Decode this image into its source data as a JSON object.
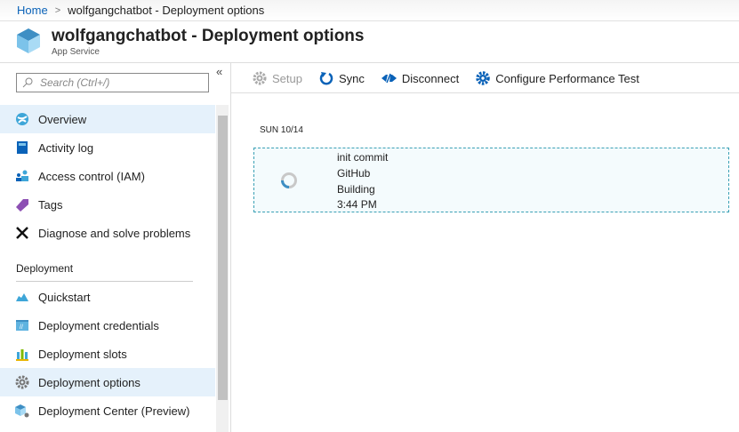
{
  "breadcrumb": {
    "home": "Home",
    "current": "wolfgangchatbot - Deployment options"
  },
  "header": {
    "title": "wolfgangchatbot - Deployment options",
    "subtitle": "App Service"
  },
  "sidebar": {
    "search_placeholder": "Search (Ctrl+/)",
    "collapse": "«",
    "items": [
      {
        "label": "Overview",
        "icon": "overview-icon"
      },
      {
        "label": "Activity log",
        "icon": "activity-log-icon"
      },
      {
        "label": "Access control (IAM)",
        "icon": "iam-icon"
      },
      {
        "label": "Tags",
        "icon": "tag-icon"
      },
      {
        "label": "Diagnose and solve problems",
        "icon": "wrench-icon"
      }
    ],
    "section": "Deployment",
    "deploy_items": [
      {
        "label": "Quickstart",
        "icon": "cloud-icon"
      },
      {
        "label": "Deployment credentials",
        "icon": "credentials-icon"
      },
      {
        "label": "Deployment slots",
        "icon": "slots-icon"
      },
      {
        "label": "Deployment options",
        "icon": "gear-icon",
        "selected": true
      },
      {
        "label": "Deployment Center (Preview)",
        "icon": "deployment-center-icon"
      }
    ]
  },
  "toolbar": {
    "setup": "Setup",
    "sync": "Sync",
    "disconnect": "Disconnect",
    "perf": "Configure Performance Test"
  },
  "deployments": {
    "date": "SUN 10/14",
    "entry": {
      "message": "init commit",
      "source": "GitHub",
      "status": "Building",
      "time": "3:44 PM"
    }
  },
  "colors": {
    "accent": "#0a62b8",
    "selected": "#e5f1fb",
    "card_border": "#3aa0b5"
  }
}
